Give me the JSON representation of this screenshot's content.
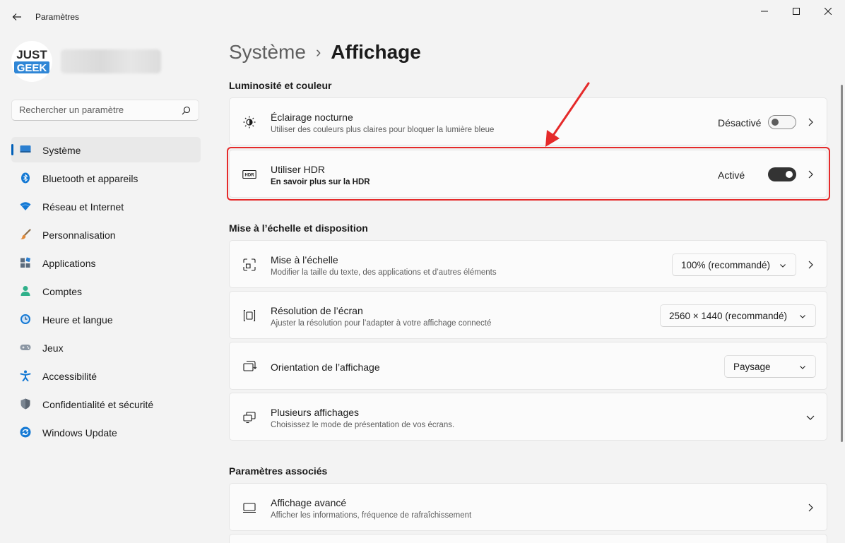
{
  "window": {
    "title": "Paramètres"
  },
  "profile": {
    "logo_line1": "JUST",
    "logo_line2": "GEEK"
  },
  "search": {
    "placeholder": "Rechercher un paramètre"
  },
  "sidebar": {
    "items": [
      {
        "label": "Système",
        "icon": "display-icon",
        "selected": true
      },
      {
        "label": "Bluetooth et appareils",
        "icon": "bluetooth-icon"
      },
      {
        "label": "Réseau et Internet",
        "icon": "wifi-icon"
      },
      {
        "label": "Personnalisation",
        "icon": "brush-icon"
      },
      {
        "label": "Applications",
        "icon": "apps-icon"
      },
      {
        "label": "Comptes",
        "icon": "account-icon"
      },
      {
        "label": "Heure et langue",
        "icon": "clock-globe-icon"
      },
      {
        "label": "Jeux",
        "icon": "gamepad-icon"
      },
      {
        "label": "Accessibilité",
        "icon": "accessibility-icon"
      },
      {
        "label": "Confidentialité et sécurité",
        "icon": "shield-icon"
      },
      {
        "label": "Windows Update",
        "icon": "update-icon"
      }
    ]
  },
  "breadcrumb": {
    "parent": "Système",
    "separator": "›",
    "current": "Affichage"
  },
  "sections": {
    "brightness": {
      "title": "Luminosité et couleur",
      "night_light": {
        "title": "Éclairage nocturne",
        "subtitle": "Utiliser des couleurs plus claires pour bloquer la lumière bleue",
        "state": "Désactivé"
      },
      "hdr": {
        "title": "Utiliser HDR",
        "subtitle": "En savoir plus sur la HDR",
        "state": "Activé",
        "icon_text": "HDR"
      }
    },
    "scale": {
      "title": "Mise à l’échelle et disposition",
      "scaling": {
        "title": "Mise à l’échelle",
        "subtitle": "Modifier la taille du texte, des applications et d’autres éléments",
        "value": "100% (recommandé)"
      },
      "resolution": {
        "title": "Résolution de l’écran",
        "subtitle": "Ajuster  la résolution pour l’adapter à votre  affichage connecté",
        "value": "2560 × 1440 (recommandé)"
      },
      "orientation": {
        "title": "Orientation de l’affichage",
        "value": "Paysage"
      },
      "multiple": {
        "title": "Plusieurs affichages",
        "subtitle": "Choisissez le mode de présentation de vos écrans."
      }
    },
    "related": {
      "title": "Paramètres associés",
      "advanced": {
        "title": "Affichage avancé",
        "subtitle": "Afficher les informations, fréquence de rafraîchissement"
      }
    }
  },
  "colors": {
    "accent": "#005fb8",
    "annotation": "#e52a2a"
  }
}
